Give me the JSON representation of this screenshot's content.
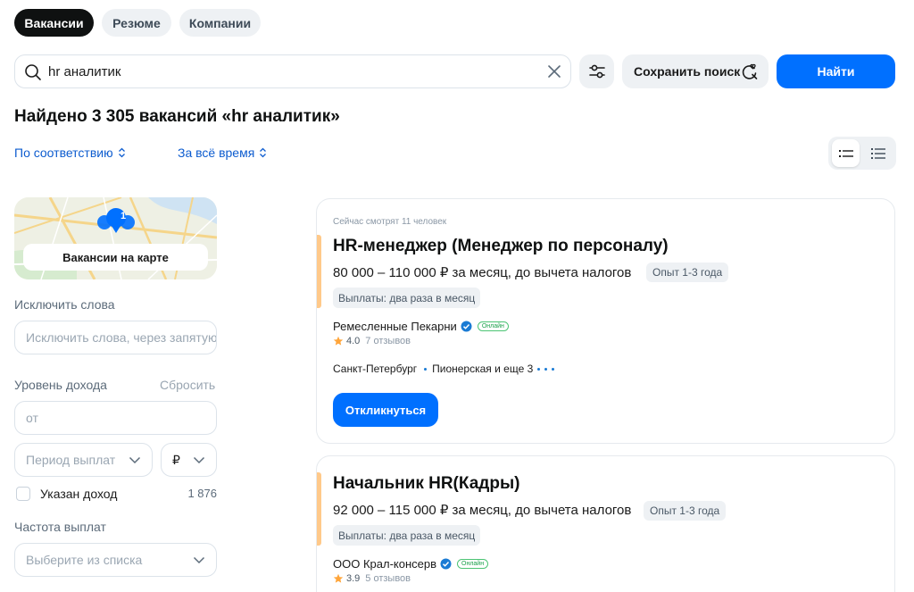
{
  "tabs": [
    {
      "label": "Вакансии",
      "active": true
    },
    {
      "label": "Резюме",
      "active": false
    },
    {
      "label": "Компании",
      "active": false
    }
  ],
  "search": {
    "value": "hr аналитик",
    "save_label": "Сохранить поиск",
    "find_label": "Найти"
  },
  "results": {
    "title": "Найдено 3 305 вакансий «hr аналитик»",
    "sort_label": "По соответствию",
    "period_label": "За всё время"
  },
  "sidebar": {
    "map_count": "1",
    "map_label": "Вакансии на карте",
    "exclude_label": "Исключить слова",
    "exclude_placeholder": "Исключить слова, через запятую",
    "income_label": "Уровень дохода",
    "reset_label": "Сбросить",
    "income_from_placeholder": "от",
    "period_placeholder": "Период выплат",
    "currency": "₽",
    "income_specified_label": "Указан доход",
    "income_specified_count": "1 876",
    "frequency_label": "Частота выплат",
    "frequency_placeholder": "Выберите из списка"
  },
  "vacancies": [
    {
      "viewers": "Сейчас смотрят 11 человек",
      "title": "HR-менеджер (Менеджер по персоналу)",
      "salary": "80 000 – 110 000 ₽ за месяц, до вычета налогов",
      "experience": "Опыт 1-3 года",
      "payout": "Выплаты: два раза в месяц",
      "company": "Ремесленные Пекарни",
      "online": "Онлайн",
      "rating": "4.0",
      "reviews": "7 отзывов",
      "city": "Санкт-Петербург",
      "metro": "Пионерская и еще 3",
      "apply_label": "Откликнуться"
    },
    {
      "title": "Начальник HR(Кадры)",
      "salary": "92 000 – 115 000 ₽ за месяц, до вычета налогов",
      "experience": "Опыт 1-3 года",
      "payout": "Выплаты: два раза в месяц",
      "company": "ООО Крал-консерв",
      "online": "Онлайн",
      "rating": "3.9",
      "reviews": "5 отзывов"
    }
  ],
  "colors": {
    "primary": "#0070ff",
    "accent_bar": "#ffc98a",
    "link": "#0d5ccf",
    "star": "#ffa53a",
    "verified": "#1a7bd4",
    "online": "#1aa04a"
  }
}
